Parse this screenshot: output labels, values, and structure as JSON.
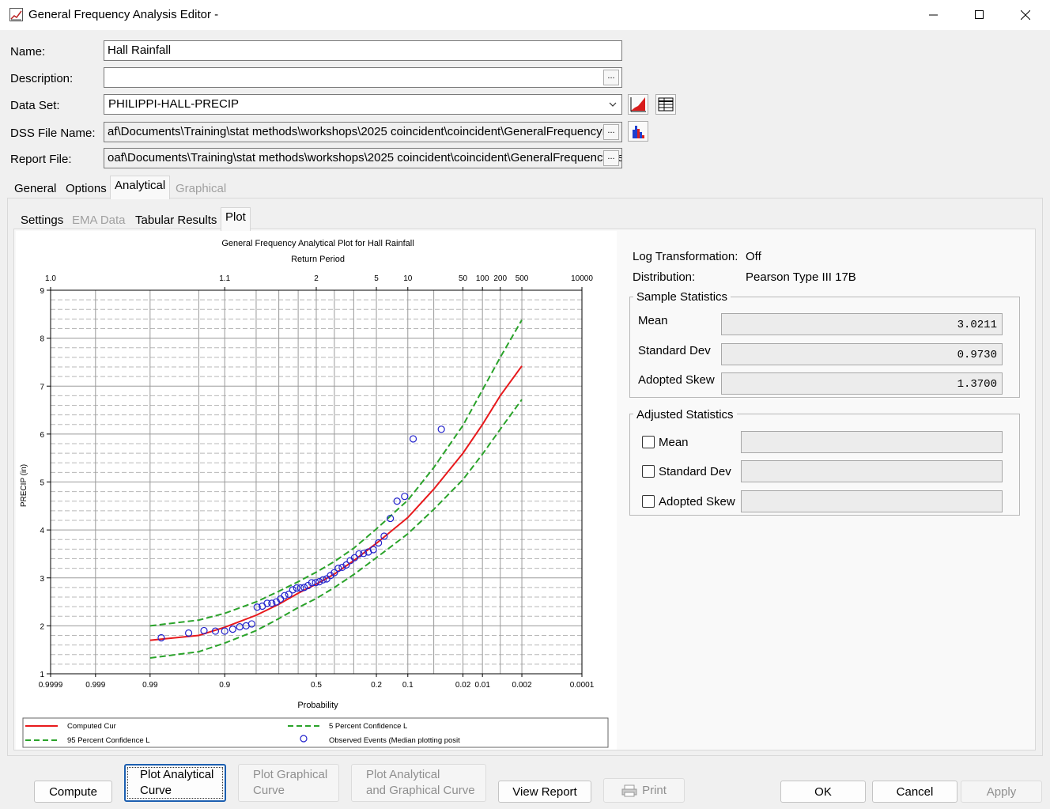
{
  "window": {
    "title": "General Frequency Analysis Editor -"
  },
  "form": {
    "name_label": "Name:",
    "name_value": "Hall Rainfall",
    "description_label": "Description:",
    "description_value": "",
    "dataset_label": "Data Set:",
    "dataset_value": "PHILIPPI-HALL-PRECIP",
    "dss_label": "DSS File Name:",
    "dss_value": "af\\Documents\\Training\\stat methods\\workshops\\2025 coincident\\coincident\\GeneralFrequencyRe",
    "report_label": "Report File:",
    "report_value": "oaf\\Documents\\Training\\stat methods\\workshops\\2025 coincident\\coincident\\GeneralFrequencyRe",
    "ellipsis": "..."
  },
  "main_tabs": [
    "General",
    "Options",
    "Analytical",
    "Graphical"
  ],
  "sub_tabs": [
    "Settings",
    "EMA Data",
    "Tabular Results",
    "Plot"
  ],
  "info": {
    "log_label": "Log Transformation:",
    "log_value": "Off",
    "dist_label": "Distribution:",
    "dist_value": "Pearson Type III 17B"
  },
  "sample_stats": {
    "title": "Sample Statistics",
    "mean_label": "Mean",
    "mean_value": "3.0211",
    "sd_label": "Standard Dev",
    "sd_value": "0.9730",
    "skew_label": "Adopted Skew",
    "skew_value": "1.3700"
  },
  "adjusted_stats": {
    "title": "Adjusted Statistics",
    "mean_label": "Mean",
    "sd_label": "Standard Dev",
    "skew_label": "Adopted Skew"
  },
  "buttons": {
    "compute": "Compute",
    "plot_analytical_1": "Plot Analytical",
    "plot_analytical_2": "Curve",
    "plot_graphical_1": "Plot Graphical",
    "plot_graphical_2": "Curve",
    "plot_both_1": "Plot Analytical",
    "plot_both_2": "and Graphical Curve",
    "view_report": "View Report",
    "print": "Print",
    "ok": "OK",
    "cancel": "Cancel",
    "apply": "Apply"
  },
  "chart_data": {
    "type": "line",
    "title": "General Frequency Analytical Plot for Hall Rainfall",
    "top_axis_label": "Return Period",
    "xlabel": "Probability",
    "ylabel": "PRECIP (in)",
    "x_scale": "normal-probability",
    "ylim": [
      1,
      9
    ],
    "y_ticks": [
      1,
      2,
      3,
      4,
      5,
      6,
      7,
      8,
      9
    ],
    "x_ticks": [
      {
        "p": 0.9999,
        "label": "0.9999"
      },
      {
        "p": 0.999,
        "label": "0.999"
      },
      {
        "p": 0.99,
        "label": "0.99"
      },
      {
        "p": 0.9,
        "label": "0.9"
      },
      {
        "p": 0.5,
        "label": "0.5"
      },
      {
        "p": 0.2,
        "label": "0.2"
      },
      {
        "p": 0.1,
        "label": "0.1"
      },
      {
        "p": 0.02,
        "label": "0.02"
      },
      {
        "p": 0.01,
        "label": "0.01"
      },
      {
        "p": 0.002,
        "label": "0.002"
      },
      {
        "p": 0.0001,
        "label": "0.0001"
      }
    ],
    "top_ticks": [
      {
        "p": 0.9999,
        "label": "1.0"
      },
      {
        "p": 0.9,
        "label": "1.1"
      },
      {
        "p": 0.5,
        "label": "2"
      },
      {
        "p": 0.2,
        "label": "5"
      },
      {
        "p": 0.1,
        "label": "10"
      },
      {
        "p": 0.02,
        "label": "50"
      },
      {
        "p": 0.01,
        "label": "100"
      },
      {
        "p": 0.005,
        "label": "200"
      },
      {
        "p": 0.002,
        "label": "500"
      },
      {
        "p": 0.0001,
        "label": "10000"
      }
    ],
    "series": [
      {
        "name": "Computed Cur",
        "color": "#e8191c",
        "style": "solid",
        "points": [
          [
            0.99,
            1.7
          ],
          [
            0.95,
            1.8
          ],
          [
            0.9,
            1.97
          ],
          [
            0.8,
            2.22
          ],
          [
            0.7,
            2.45
          ],
          [
            0.6,
            2.68
          ],
          [
            0.5,
            2.87
          ],
          [
            0.4,
            3.08
          ],
          [
            0.3,
            3.36
          ],
          [
            0.2,
            3.72
          ],
          [
            0.1,
            4.26
          ],
          [
            0.05,
            4.85
          ],
          [
            0.02,
            5.6
          ],
          [
            0.01,
            6.2
          ],
          [
            0.005,
            6.8
          ],
          [
            0.002,
            7.42
          ]
        ]
      },
      {
        "name": "5 Percent Confidence L",
        "color": "#2aa32a",
        "style": "dashed",
        "points": [
          [
            0.99,
            2.0
          ],
          [
            0.95,
            2.12
          ],
          [
            0.9,
            2.26
          ],
          [
            0.8,
            2.5
          ],
          [
            0.7,
            2.72
          ],
          [
            0.6,
            2.92
          ],
          [
            0.5,
            3.12
          ],
          [
            0.4,
            3.34
          ],
          [
            0.3,
            3.62
          ],
          [
            0.2,
            4.02
          ],
          [
            0.1,
            4.62
          ],
          [
            0.05,
            5.3
          ],
          [
            0.02,
            6.18
          ],
          [
            0.01,
            6.92
          ],
          [
            0.005,
            7.6
          ],
          [
            0.002,
            8.38
          ]
        ]
      },
      {
        "name": "95 Percent Confidence L",
        "color": "#2aa32a",
        "style": "dashed",
        "points": [
          [
            0.99,
            1.33
          ],
          [
            0.95,
            1.46
          ],
          [
            0.9,
            1.64
          ],
          [
            0.8,
            1.9
          ],
          [
            0.7,
            2.15
          ],
          [
            0.6,
            2.38
          ],
          [
            0.5,
            2.57
          ],
          [
            0.4,
            2.8
          ],
          [
            0.3,
            3.07
          ],
          [
            0.2,
            3.42
          ],
          [
            0.1,
            3.92
          ],
          [
            0.05,
            4.43
          ],
          [
            0.02,
            5.05
          ],
          [
            0.01,
            5.58
          ],
          [
            0.005,
            6.1
          ],
          [
            0.002,
            6.72
          ]
        ]
      }
    ],
    "observed": {
      "name": "Observed Events (Median plotting posit",
      "color": "#2222cc",
      "points": [
        [
          0.985,
          1.75
        ],
        [
          0.963,
          1.85
        ],
        [
          0.942,
          1.9
        ],
        [
          0.921,
          1.89
        ],
        [
          0.9,
          1.89
        ],
        [
          0.879,
          1.93
        ],
        [
          0.858,
          1.98
        ],
        [
          0.837,
          2.0
        ],
        [
          0.817,
          2.04
        ],
        [
          0.796,
          2.39
        ],
        [
          0.775,
          2.41
        ],
        [
          0.754,
          2.47
        ],
        [
          0.733,
          2.47
        ],
        [
          0.712,
          2.5
        ],
        [
          0.692,
          2.56
        ],
        [
          0.671,
          2.63
        ],
        [
          0.65,
          2.66
        ],
        [
          0.629,
          2.75
        ],
        [
          0.608,
          2.79
        ],
        [
          0.587,
          2.79
        ],
        [
          0.567,
          2.8
        ],
        [
          0.546,
          2.84
        ],
        [
          0.525,
          2.9
        ],
        [
          0.504,
          2.9
        ],
        [
          0.483,
          2.92
        ],
        [
          0.462,
          2.96
        ],
        [
          0.442,
          2.98
        ],
        [
          0.421,
          3.05
        ],
        [
          0.4,
          3.11
        ],
        [
          0.379,
          3.2
        ],
        [
          0.358,
          3.22
        ],
        [
          0.337,
          3.27
        ],
        [
          0.317,
          3.36
        ],
        [
          0.296,
          3.42
        ],
        [
          0.275,
          3.5
        ],
        [
          0.254,
          3.51
        ],
        [
          0.233,
          3.54
        ],
        [
          0.212,
          3.59
        ],
        [
          0.192,
          3.73
        ],
        [
          0.171,
          3.87
        ],
        [
          0.15,
          4.24
        ],
        [
          0.129,
          4.6
        ],
        [
          0.108,
          4.7
        ],
        [
          0.0875,
          5.9
        ],
        [
          0.04,
          6.1
        ]
      ]
    }
  }
}
